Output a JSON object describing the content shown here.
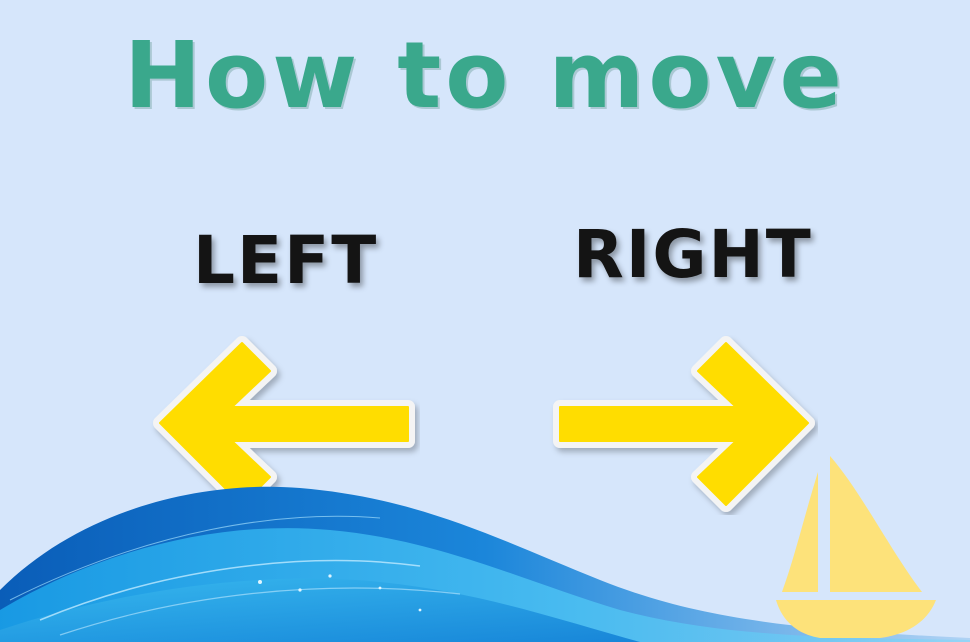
{
  "title": "How to move",
  "controls": {
    "left": {
      "label": "LEFT",
      "direction": "left",
      "icon": "left-arrow-icon"
    },
    "right": {
      "label": "RIGHT",
      "direction": "right",
      "icon": "right-arrow-icon"
    }
  },
  "colors": {
    "background": "#d6e6fb",
    "title": "#3aa88c",
    "arrow_fill": "#ffdd00",
    "arrow_outline": "#f4f4f4",
    "label": "#141414",
    "wave_dark": "#1270c9",
    "wave_light": "#3fb4ee",
    "sail": "#fde27a"
  },
  "decorations": {
    "waves": "ocean-waves",
    "boat": "sailboat-icon"
  }
}
